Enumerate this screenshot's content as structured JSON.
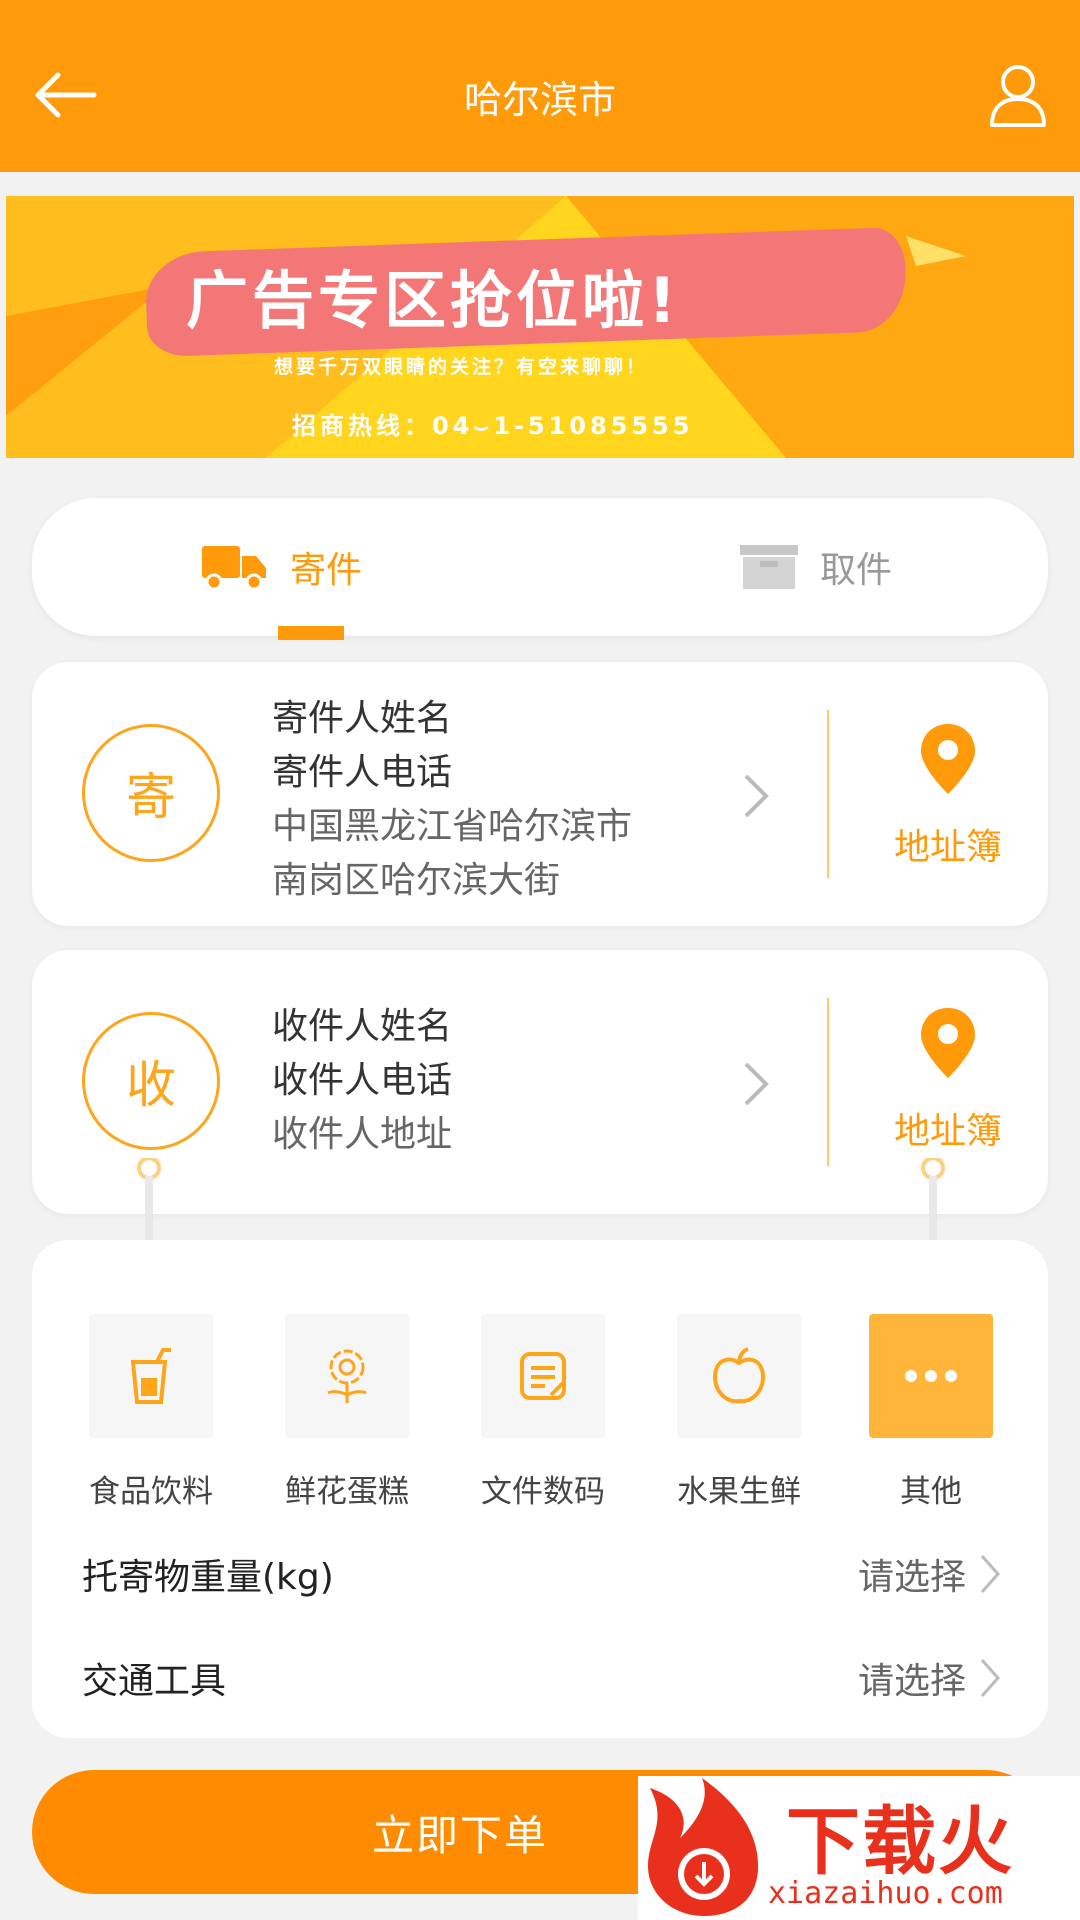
{
  "header": {
    "title": "哈尔滨市",
    "bg_color": "#ff9a0a"
  },
  "banner": {
    "headline": "广告专区抢位啦!",
    "subline": "想要千万双眼睛的关注？有空来聊聊！",
    "hotline": "招商热线：04⌣1-51085555"
  },
  "tabs": [
    {
      "label": "寄件",
      "icon": "truck-icon",
      "active": true
    },
    {
      "label": "取件",
      "icon": "box-icon",
      "active": false
    }
  ],
  "sender": {
    "badge": "寄",
    "name": "寄件人姓名",
    "phone": "寄件人电话",
    "address_line1": "中国黑龙江省哈尔滨市",
    "address_line2": "南岗区哈尔滨大街",
    "address_book": "地址簿"
  },
  "receiver": {
    "badge": "收",
    "name": "收件人姓名",
    "phone": "收件人电话",
    "address": "收件人地址",
    "address_book": "地址簿"
  },
  "categories": [
    {
      "label": "食品饮料",
      "icon": "drink-icon",
      "selected": false
    },
    {
      "label": "鲜花蛋糕",
      "icon": "flower-icon",
      "selected": false
    },
    {
      "label": "文件数码",
      "icon": "document-icon",
      "selected": false
    },
    {
      "label": "水果生鲜",
      "icon": "apple-icon",
      "selected": false
    },
    {
      "label": "其他",
      "icon": "more-icon",
      "selected": true
    }
  ],
  "fields": [
    {
      "label": "托寄物重量(kg)",
      "value": "请选择"
    },
    {
      "label": "交通工具",
      "value": "请选择"
    }
  ],
  "submit_label": "立即下单",
  "watermark": {
    "brand": "下载火",
    "url": "xiazaihuo.com"
  },
  "colors": {
    "accent": "#ff9a0a",
    "accent_light": "#ffb53a",
    "banner_red": "#f47777",
    "watermark_red": "#e8301c"
  }
}
